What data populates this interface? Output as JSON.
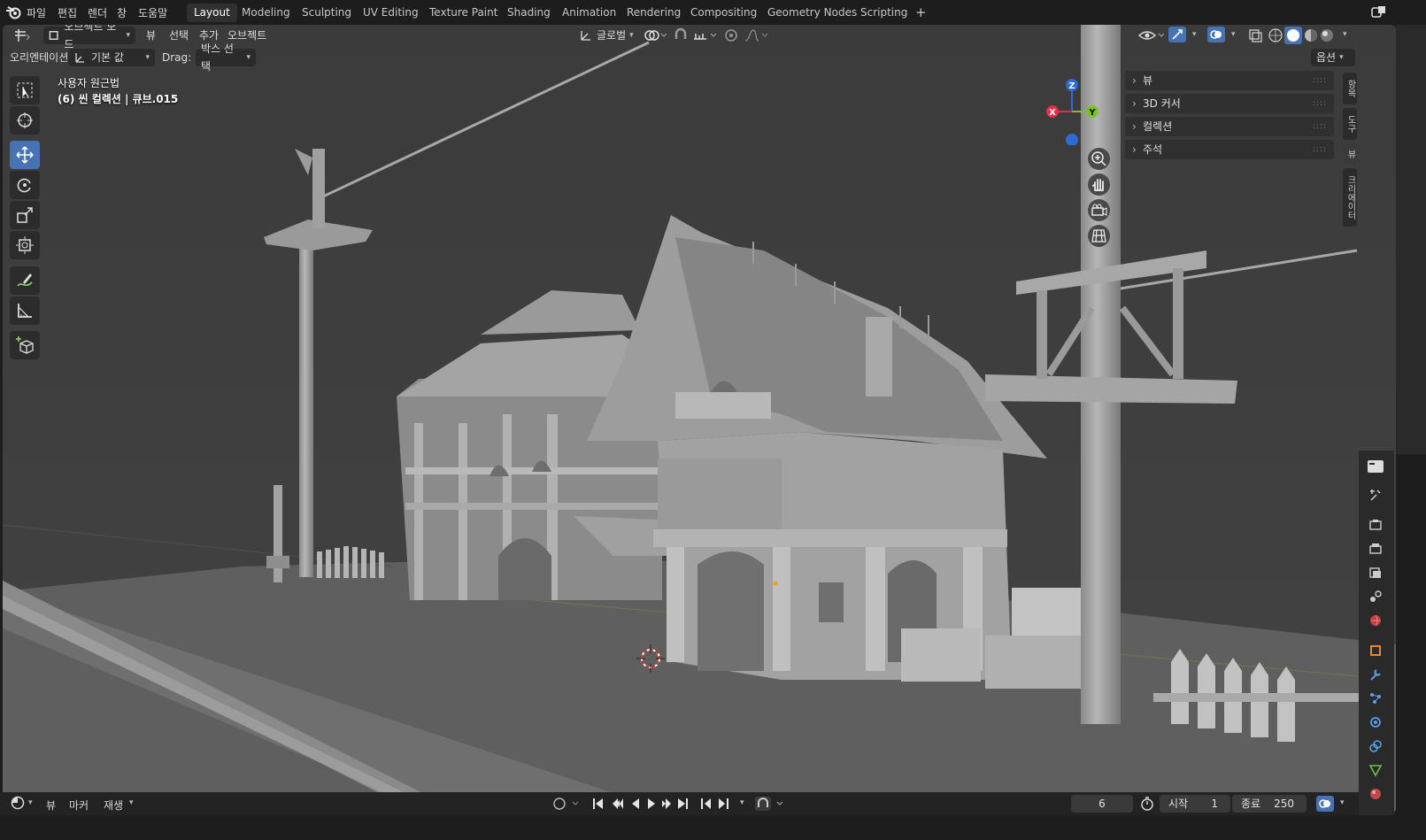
{
  "menubar": {
    "items": [
      "파일",
      "편집",
      "렌더",
      "창",
      "도움말"
    ],
    "workspaces": [
      "Layout",
      "Modeling",
      "Sculpting",
      "UV Editing",
      "Texture Paint",
      "Shading",
      "Animation",
      "Rendering",
      "Compositing",
      "Geometry Nodes",
      "Scripting"
    ],
    "active_workspace": "Layout",
    "add_tab": "+"
  },
  "viewport_header": {
    "mode": "오브젝트 모드",
    "menus": [
      "뷰",
      "선택",
      "추가",
      "오브젝트"
    ],
    "transform_orientation": "글로벌"
  },
  "tool_settings": {
    "orientation_label": "오리엔테이션:",
    "orientation_value": "기본 값",
    "drag_label": "Drag:",
    "drag_value": "박스 선택",
    "options_label": "옵션"
  },
  "overlay": {
    "view_name": "사용자 원근법",
    "collection_info": "(6) 씬 컬렉션 | 큐브.015"
  },
  "gizmo": {
    "x": "X",
    "y": "Y",
    "z": "Z"
  },
  "sidebar": {
    "panels": [
      "뷰",
      "3D 커서",
      "컬렉션",
      "주석"
    ],
    "tabs": [
      "항목",
      "도구",
      "뷰",
      "크리에이터"
    ]
  },
  "toolbar": {
    "tools": [
      "select-box-icon",
      "cursor-icon",
      "move-icon",
      "rotate-icon",
      "scale-icon",
      "transform-icon",
      "annotate-icon",
      "measure-icon",
      "add-cube-icon"
    ],
    "active_tool": "move-icon"
  },
  "timeline": {
    "menus": [
      "뷰",
      "마커",
      "재생"
    ],
    "current_frame": "6",
    "start_label": "시작",
    "start_value": "1",
    "end_label": "종료",
    "end_value": "250"
  },
  "colors": {
    "accent": "#4772b3",
    "axis_x": "#e0304a",
    "axis_y": "#7ec02a",
    "axis_z": "#2e6ad6",
    "viewport_bg": "#3d3d3d"
  }
}
